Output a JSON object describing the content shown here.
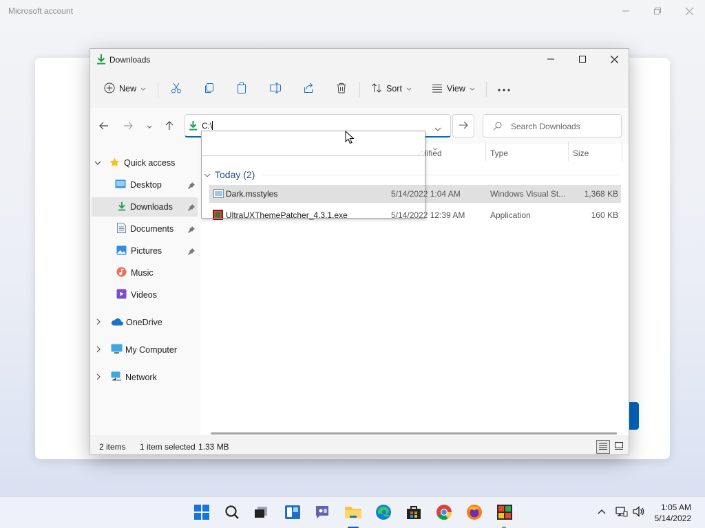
{
  "background": {
    "window_title": "Microsoft account"
  },
  "explorer": {
    "title": "Downloads",
    "toolbar": {
      "new_label": "New",
      "sort_label": "Sort",
      "view_label": "View"
    },
    "address": {
      "value": "C:\\"
    },
    "search": {
      "placeholder": "Search Downloads"
    },
    "sidebar": {
      "quick_access": "Quick access",
      "items": [
        {
          "label": "Desktop",
          "icon": "desktop-icon",
          "pinned": true
        },
        {
          "label": "Downloads",
          "icon": "download-icon",
          "pinned": true,
          "selected": true
        },
        {
          "label": "Documents",
          "icon": "documents-icon",
          "pinned": true
        },
        {
          "label": "Pictures",
          "icon": "pictures-icon",
          "pinned": true
        },
        {
          "label": "Music",
          "icon": "music-icon"
        },
        {
          "label": "Videos",
          "icon": "videos-icon"
        }
      ],
      "roots": [
        {
          "label": "OneDrive",
          "icon": "onedrive-icon"
        },
        {
          "label": "My Computer",
          "icon": "computer-icon"
        },
        {
          "label": "Network",
          "icon": "network-icon"
        }
      ]
    },
    "columns": {
      "modified_fragment": "lified",
      "type": "Type",
      "size": "Size"
    },
    "group_label": "Today (2)",
    "files": [
      {
        "name": "Dark.msstyles",
        "date": "5/14/2022 1:04 AM",
        "type": "Windows Visual St...",
        "size": "1,368 KB",
        "selected": true
      },
      {
        "name": "UltraUXThemePatcher_4.3.1.exe",
        "date": "5/14/2022 12:39 AM",
        "type": "Application",
        "size": "160 KB"
      }
    ],
    "status": {
      "items": "2 items",
      "selected": "1 item selected",
      "size": "1.33 MB"
    }
  },
  "taskbar": {
    "time": "1:05 AM",
    "date": "5/14/2022"
  },
  "colors": {
    "accent": "#0067c0",
    "folder": "#f3c34a",
    "download_green": "#1d9a4e"
  }
}
